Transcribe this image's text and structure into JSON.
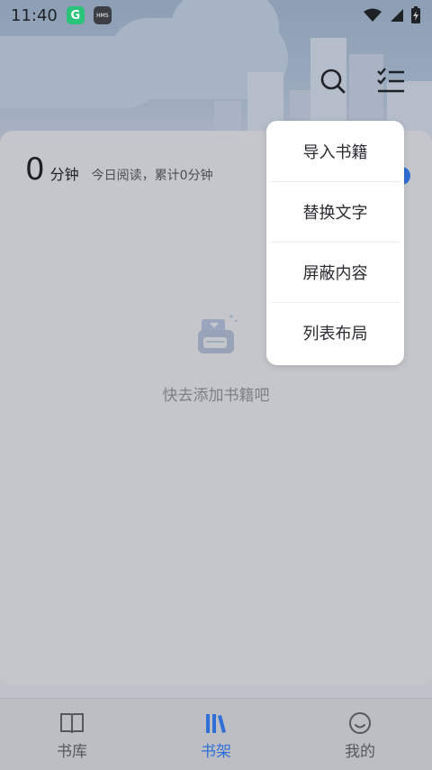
{
  "status_bar": {
    "time": "11:40",
    "hms_label": "HMS"
  },
  "header": {
    "search_icon": "search-icon",
    "menu_icon": "list-menu-icon"
  },
  "reading": {
    "minutes": "0",
    "unit": "分钟",
    "summary": "今日阅读，累计0分钟"
  },
  "empty_state": {
    "icon": "book-bin-icon",
    "text": "快去添加书籍吧"
  },
  "popup_menu": {
    "items": [
      {
        "label": "导入书籍"
      },
      {
        "label": "替换文字"
      },
      {
        "label": "屏蔽内容"
      },
      {
        "label": "列表布局"
      }
    ]
  },
  "bottom_nav": {
    "items": [
      {
        "label": "书库",
        "icon": "book-open-icon"
      },
      {
        "label": "书架",
        "icon": "bookshelf-icon",
        "active": true
      },
      {
        "label": "我的",
        "icon": "smiley-icon"
      }
    ]
  },
  "colors": {
    "accent": "#2f6fd6",
    "menu_bg": "#ffffff"
  }
}
